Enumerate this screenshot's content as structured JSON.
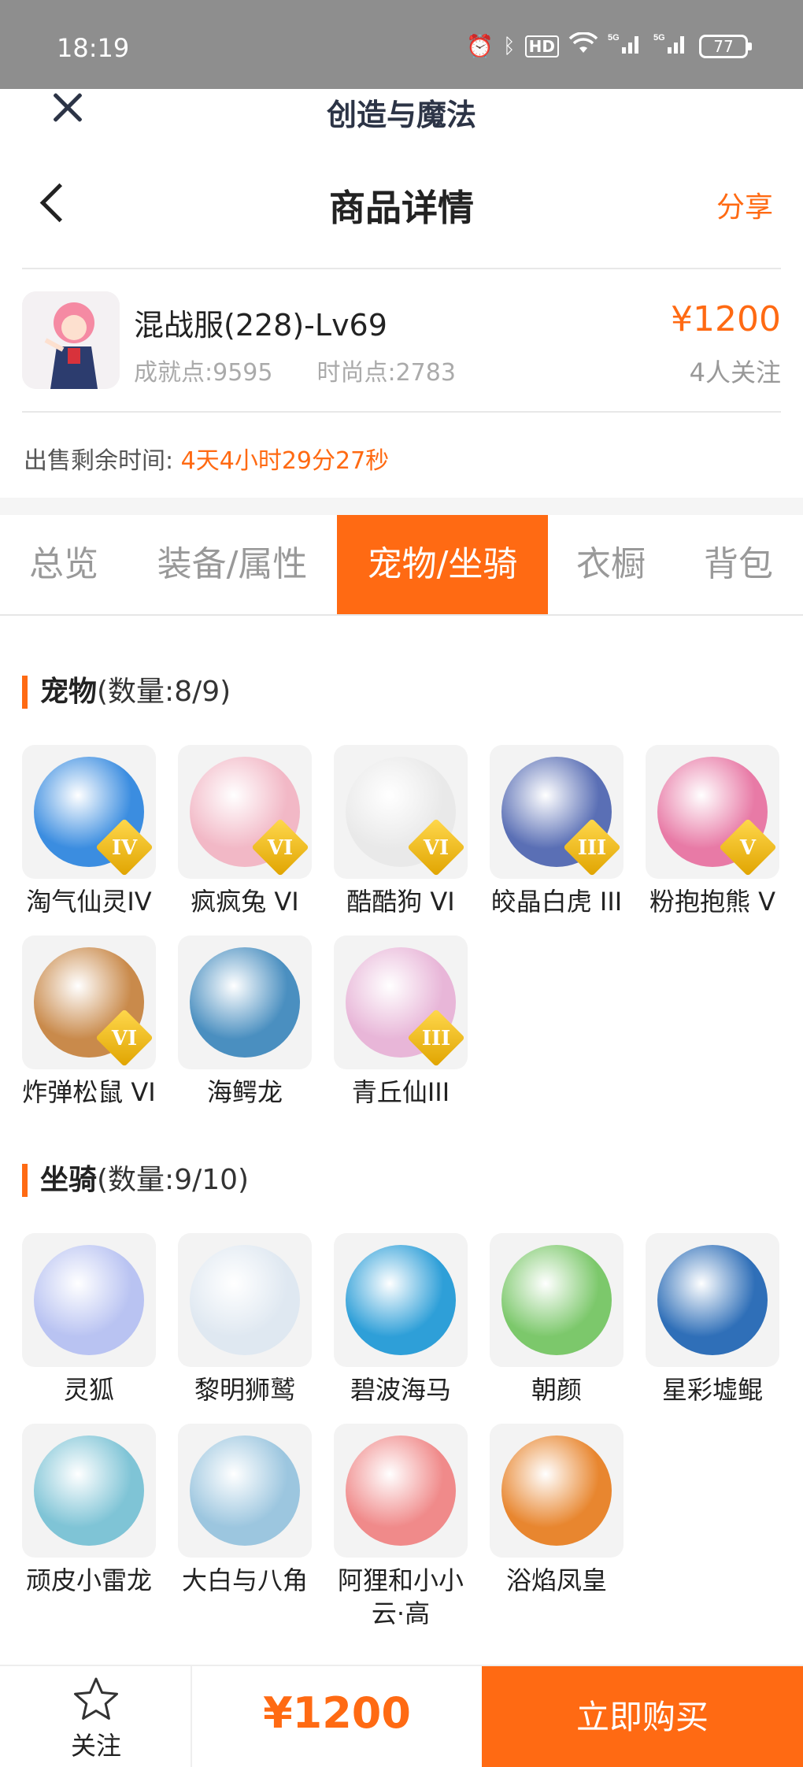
{
  "status_bar": {
    "time": "18:19",
    "battery": "77",
    "hd": "HD",
    "net1": "5G",
    "net2": "5G"
  },
  "app": {
    "mini_title": "创造与魔法"
  },
  "nav": {
    "title": "商品详情",
    "share": "分享"
  },
  "product": {
    "name": "混战服(228)-Lv69",
    "achievement": "成就点:9595",
    "fashion": "时尚点:2783",
    "price": "¥1200",
    "followers": "4人关注"
  },
  "sale": {
    "label": "出售剩余时间:",
    "remaining": "4天4小时29分27秒"
  },
  "tabs": [
    {
      "label": "总览"
    },
    {
      "label": "装备/属性"
    },
    {
      "label": "宠物/坐骑"
    },
    {
      "label": "衣橱"
    },
    {
      "label": "背包"
    }
  ],
  "pets": {
    "title": "宠物",
    "count": "(数量:8/9)",
    "items": [
      {
        "name": "淘气仙灵IV",
        "tier": "IV",
        "color": "#3b8de0"
      },
      {
        "name": "疯疯兔 VI",
        "tier": "VI",
        "color": "#f2b8c6"
      },
      {
        "name": "酷酷狗 VI",
        "tier": "VI",
        "color": "#e9e9e9"
      },
      {
        "name": "皎晶白虎 III",
        "tier": "III",
        "color": "#5a6fb5"
      },
      {
        "name": "粉抱抱熊 V",
        "tier": "V",
        "color": "#e87aa6"
      },
      {
        "name": "炸弹松鼠 VI",
        "tier": "VI",
        "color": "#c98a4b"
      },
      {
        "name": "海鳄龙",
        "tier": "",
        "color": "#4a8fc0"
      },
      {
        "name": "青丘仙III",
        "tier": "III",
        "color": "#e8b6d8"
      }
    ]
  },
  "mounts": {
    "title": "坐骑",
    "count": "(数量:9/10)",
    "items": [
      {
        "name": "灵狐",
        "color": "#b9c3f2"
      },
      {
        "name": "黎明狮鹫",
        "color": "#dfe8f1"
      },
      {
        "name": "碧波海马",
        "color": "#2e9fd8"
      },
      {
        "name": "朝颜",
        "color": "#7cc86b"
      },
      {
        "name": "星彩墟鲲",
        "color": "#2f6fb8"
      },
      {
        "name": "顽皮小雷龙",
        "color": "#7fc4d6"
      },
      {
        "name": "大白与八角",
        "color": "#9cc6df"
      },
      {
        "name": "阿狸和小小云·高",
        "color": "#f08a8a"
      },
      {
        "name": "浴焰凤皇",
        "color": "#e8862f"
      }
    ]
  },
  "bottom_bar": {
    "follow": "关注",
    "total": "¥1200",
    "buy": "立即购买"
  },
  "colors": {
    "accent": "#ff6a13"
  }
}
